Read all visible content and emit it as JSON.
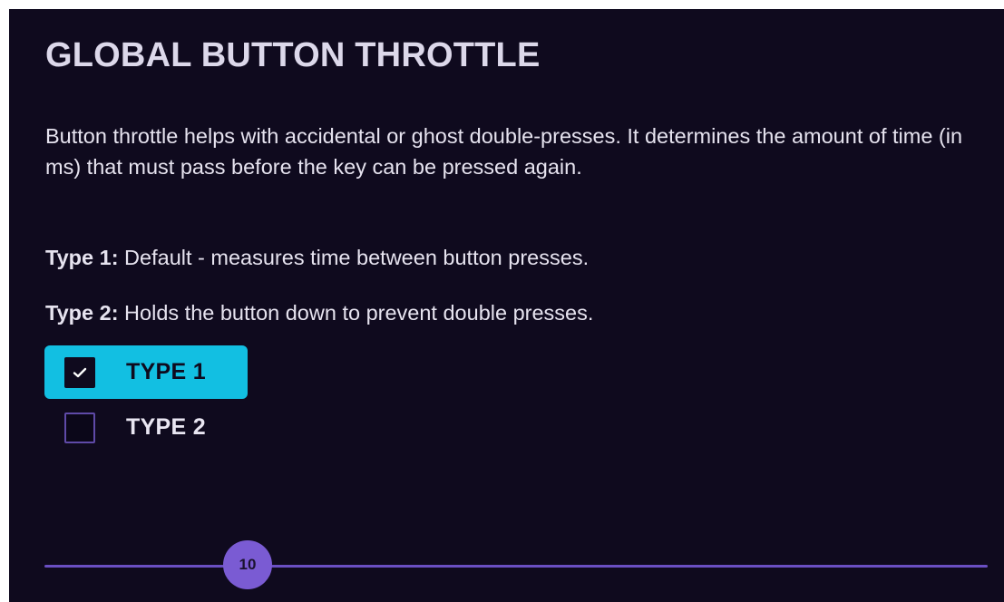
{
  "panel": {
    "title": "GLOBAL BUTTON THROTTLE",
    "description": "Button throttle helps with accidental or ghost double-presses. It determines the amount of time (in ms) that must pass before the key can be pressed again.",
    "type1_info": {
      "label": "Type 1:",
      "text": " Default - measures time between button presses."
    },
    "type2_info": {
      "label": "Type 2:",
      "text": " Holds the button down to prevent double presses."
    }
  },
  "options": [
    {
      "label": "TYPE 1",
      "checked": true
    },
    {
      "label": "TYPE 2",
      "checked": false
    }
  ],
  "slider": {
    "value": "10"
  },
  "colors": {
    "background": "#0f0a1e",
    "selected_option": "#12bfe2",
    "accent": "#7a5bd3",
    "track": "#6a4fc2"
  },
  "icons": {
    "checkmark": "check-icon"
  }
}
